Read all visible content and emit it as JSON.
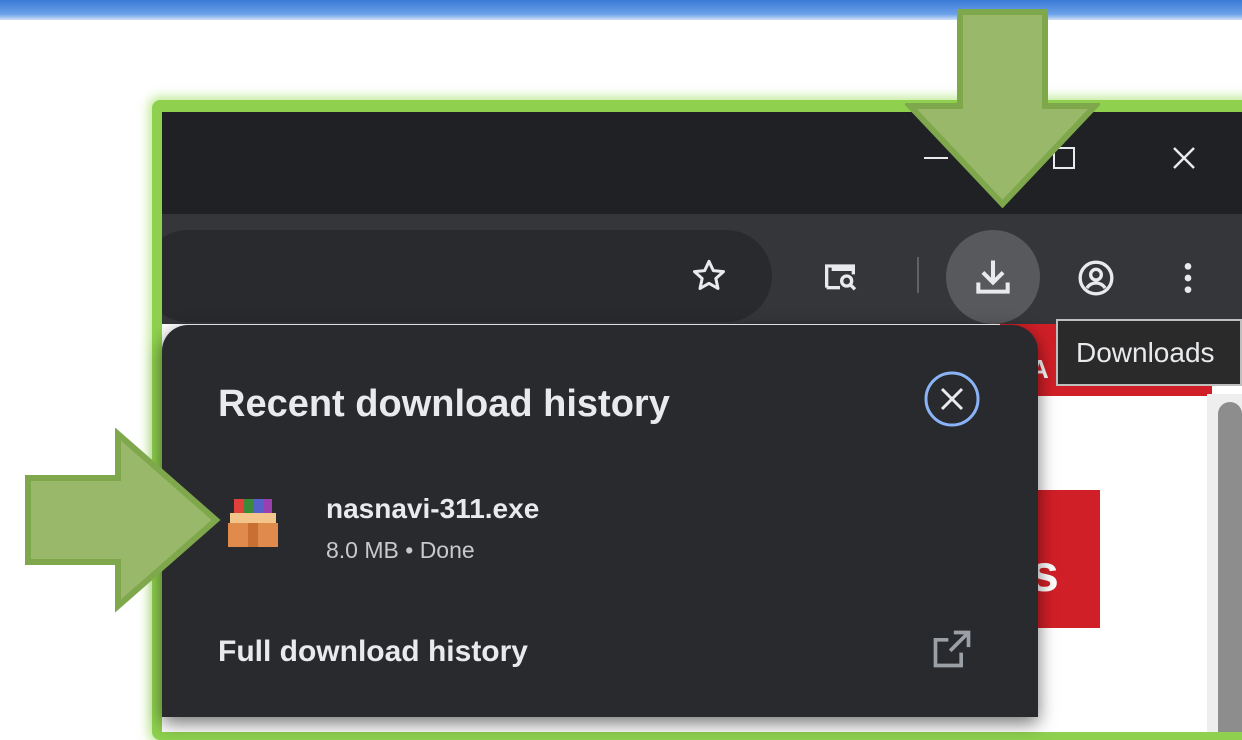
{
  "window": {
    "minimize_icon": "minimize-icon",
    "maximize_icon": "maximize-icon",
    "close_icon": "close-icon"
  },
  "toolbar": {
    "icons": [
      "star-icon",
      "search-in-page-icon",
      "download-icon",
      "profile-icon",
      "more-vert-icon"
    ]
  },
  "tooltip": {
    "text": "Downloads"
  },
  "page": {
    "red_strip_text": "A",
    "red_box_text": "s"
  },
  "downloads_panel": {
    "title": "Recent download history",
    "items": [
      {
        "file_name": "nasnavi-311.exe",
        "meta": "8.0 MB • Done",
        "icon": "archive-icon"
      }
    ],
    "full_history_label": "Full download history"
  },
  "colors": {
    "panel_bg": "#292a2d",
    "annotation_arrow": "#9ab86a",
    "frame_highlight": "#8fd14f",
    "close_ring": "#8ab4f8"
  }
}
